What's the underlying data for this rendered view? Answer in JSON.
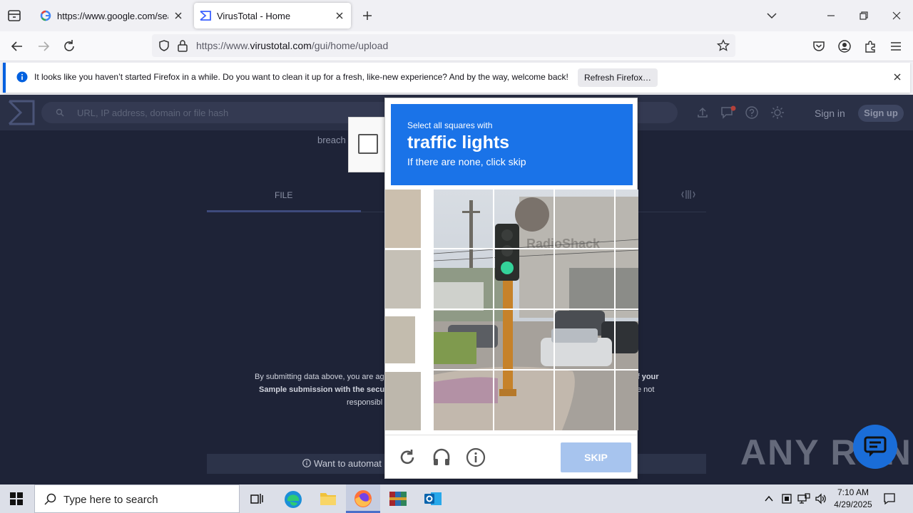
{
  "browser": {
    "tabs": [
      {
        "title": "https://www.google.com/search",
        "active": false
      },
      {
        "title": "VirusTotal - Home",
        "active": true
      }
    ],
    "url_prefix": "https://www.",
    "url_domain": "virustotal.com",
    "url_path": "/gui/home/upload"
  },
  "notification": {
    "message": "It looks like you haven’t started Firefox in a while. Do you want to clean it up for a fresh, like-new experience? And by the way, welcome back!",
    "button_label": "Refresh Firefox…"
  },
  "virustotal": {
    "search_placeholder": "URL, IP address, domain or file hash",
    "sign_in": "Sign in",
    "sign_up": "Sign up",
    "breach_text": "breach",
    "file_tab": "FILE",
    "terms_line1_left": "By submitting data above, you are ag",
    "terms_line1_right": "f your",
    "terms_line2_left": "Sample submission with the secur",
    "terms_line2_right": "e not",
    "terms_line3": "responsibl",
    "automate_text": "Want to automat"
  },
  "captcha": {
    "line1": "Select all squares with",
    "line2": "traffic lights",
    "line3": "If there are none, click skip",
    "skip_label": "SKIP"
  },
  "taskbar": {
    "search_placeholder": "Type here to search",
    "time": "7:10 AM",
    "date": "4/29/2025"
  },
  "watermark": "ANY RUN",
  "colors": {
    "captcha_blue": "#1a73e8",
    "page_bg": "#1e2337",
    "skip_button": "#a7c4ee"
  }
}
